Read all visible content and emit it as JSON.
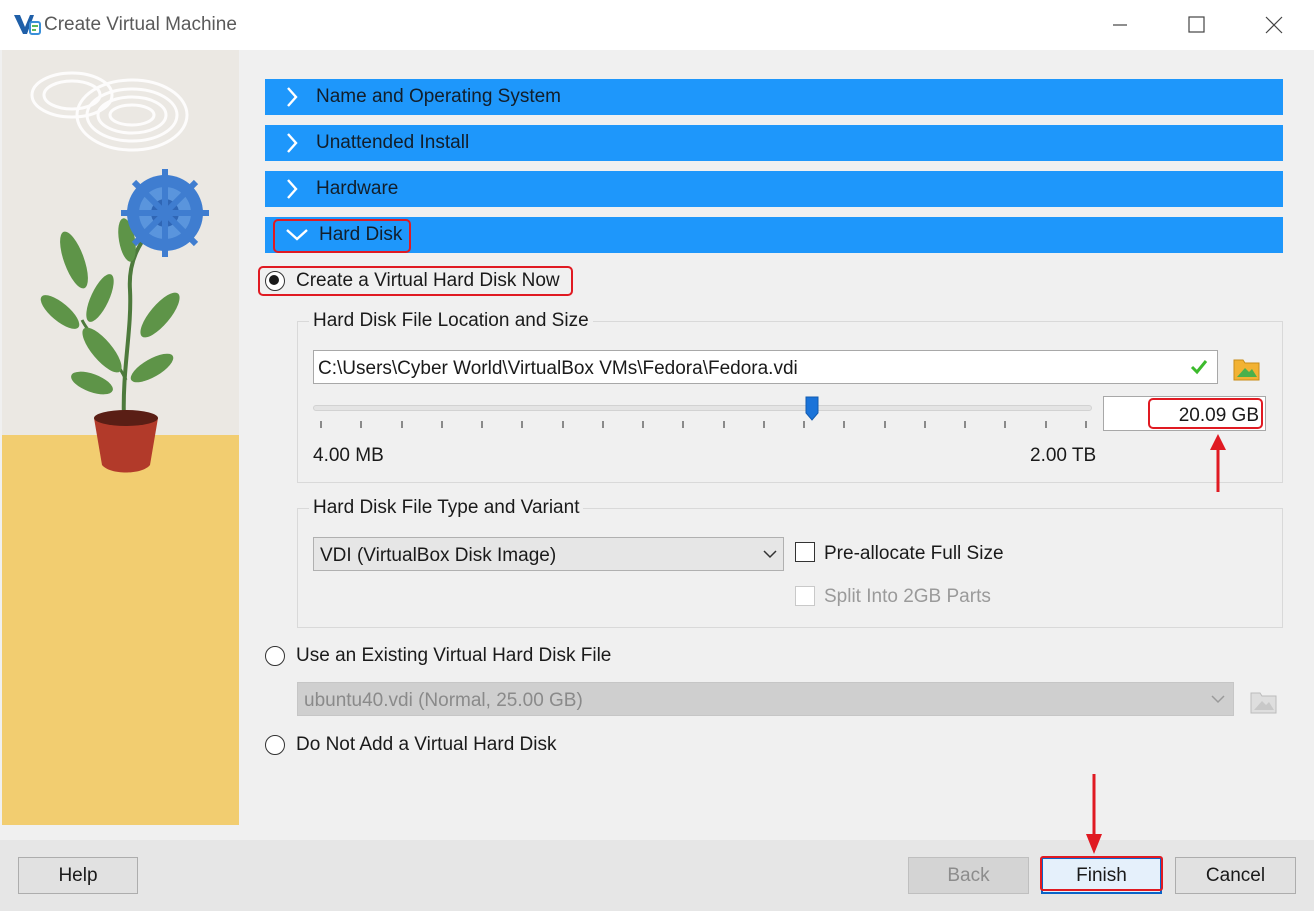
{
  "window": {
    "title": "Create Virtual Machine",
    "app_icon": "virtualbox-icon",
    "controls": [
      "minimize-icon",
      "maximize-icon",
      "close-icon"
    ]
  },
  "sections": [
    {
      "label": "Name and Operating System",
      "expanded": false
    },
    {
      "label": "Unattended Install",
      "expanded": false
    },
    {
      "label": "Hardware",
      "expanded": false
    },
    {
      "label": "Hard Disk",
      "expanded": true
    }
  ],
  "hard_disk": {
    "option_create": "Create a Virtual Hard Disk Now",
    "option_create_selected": true,
    "location_group_title": "Hard Disk File Location and Size",
    "file_path": "C:\\Users\\Cyber World\\VirtualBox VMs\\Fedora\\Fedora.vdi",
    "path_valid": true,
    "slider_min_label": "4.00 MB",
    "slider_max_label": "2.00 TB",
    "slider_position_fraction": 0.64,
    "size_value": "20.09 GB",
    "type_group_title": "Hard Disk File Type and Variant",
    "type_selected": "VDI (VirtualBox Disk Image)",
    "preallocate_label": "Pre-allocate Full Size",
    "preallocate_checked": false,
    "split_label": "Split Into 2GB Parts",
    "split_enabled": false,
    "option_existing": "Use an Existing Virtual Hard Disk File",
    "existing_selected": false,
    "existing_file": "ubuntu40.vdi (Normal, 25.00 GB)",
    "option_none": "Do Not Add a Virtual Hard Disk",
    "none_selected": false
  },
  "buttons": {
    "help": "Help",
    "back": "Back",
    "finish": "Finish",
    "cancel": "Cancel"
  },
  "colors": {
    "section_header": "#1e97fb",
    "annotation_red": "#e01a22",
    "valid_check": "#3cba2c"
  }
}
